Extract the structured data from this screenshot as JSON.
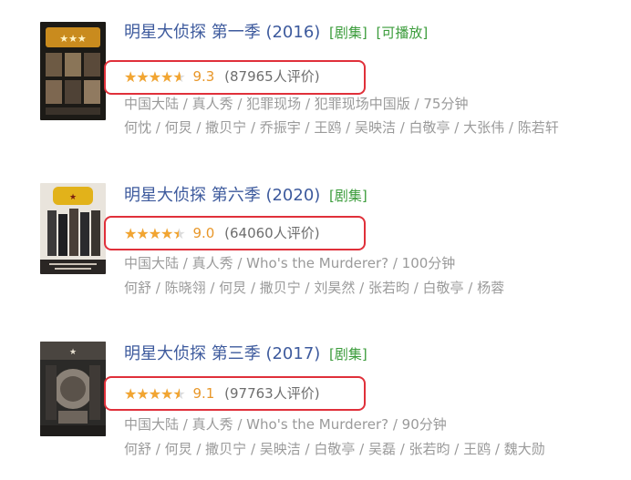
{
  "entries": [
    {
      "title": "明星大侦探 第一季 (2016)",
      "tags": [
        "[剧集]",
        "[可播放]"
      ],
      "rating": {
        "stars_fraction": 0.93,
        "score": "9.3",
        "count": "(87965人评价)"
      },
      "meta": "中国大陆 / 真人秀 / 犯罪现场 / 犯罪现场中国版 / 75分钟",
      "cast": "何忱 / 何炅 / 撒贝宁 / 乔振宇 / 王鸥 / 吴映洁 / 白敬亭 / 大张伟 / 陈若轩"
    },
    {
      "title": "明星大侦探 第六季 (2020)",
      "tags": [
        "[剧集]"
      ],
      "rating": {
        "stars_fraction": 0.9,
        "score": "9.0",
        "count": "(64060人评价)"
      },
      "meta": "中国大陆 / 真人秀 / Who's the Murderer? / 100分钟",
      "cast": "何舒 / 陈晓翎 / 何炅 / 撒贝宁 / 刘昊然 / 张若昀 / 白敬亭 / 杨蓉"
    },
    {
      "title": "明星大侦探 第三季 (2017)",
      "tags": [
        "[剧集]"
      ],
      "rating": {
        "stars_fraction": 0.91,
        "score": "9.1",
        "count": "(97763人评价)"
      },
      "meta": "中国大陆 / 真人秀 / Who's the Murderer? / 90分钟",
      "cast": "何舒 / 何炅 / 撒贝宁 / 吴映洁 / 白敬亭 / 吴磊 / 张若昀 / 王鸥 / 魏大勋"
    }
  ],
  "colors": {
    "title": "#3d5a9d",
    "tag": "#3b9c3b",
    "star": "#f2a531",
    "score": "#e8972a",
    "highlight_box": "#e0303a",
    "meta": "#9a9a9a"
  },
  "icons": {
    "star": "star-icon"
  }
}
